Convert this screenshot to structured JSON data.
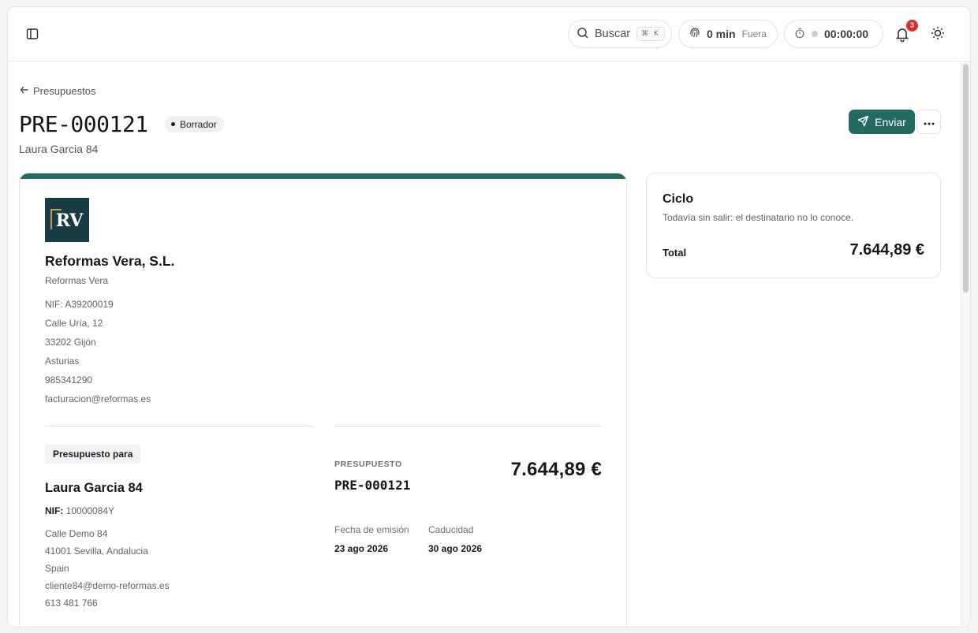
{
  "topbar": {
    "search": {
      "label": "Buscar",
      "shortcut": "⌘ K"
    },
    "presence": {
      "value": "0 min",
      "status": "Fuera"
    },
    "timer": {
      "value": "00:00:00"
    },
    "notifications": {
      "count": "3"
    },
    "icons": [
      "sidebar-toggle-icon",
      "search-icon",
      "fingerprint-icon",
      "stopwatch-icon",
      "bell-icon",
      "sun-icon"
    ]
  },
  "header": {
    "back_label": "Presupuestos",
    "title": "PRE-000121",
    "status": "Borrador",
    "subtitle": "Laura Garcia 84",
    "send_label": "Enviar",
    "more_label": "···"
  },
  "document": {
    "accent_color": "#236b62",
    "logo_text": "RV",
    "issuer": {
      "name": "Reformas Vera, S.L.",
      "trade_name": "Reformas Vera",
      "lines": [
        "NIF: A39200019",
        "Calle Uría, 12",
        "33202 Gijón",
        "Asturias",
        "985341290",
        "facturacion@reformas.es"
      ]
    },
    "client": {
      "tag": "Presupuesto para",
      "name": "Laura Garcia 84",
      "nif_label": "NIF:",
      "nif_value": "10000084Y",
      "lines": [
        "Calle Demo 84",
        "41001 Sevilla, Andalucia",
        "Spain",
        "cliente84@demo-reformas.es",
        "613 481 766"
      ]
    },
    "summary": {
      "label": "PRESUPUESTO",
      "number": "PRE-000121",
      "total": "7.644,89 €",
      "issue_date_label": "Fecha de emisión",
      "issue_date": "23 ago 2026",
      "expiry_label": "Caducidad",
      "expiry_date": "30 ago 2026"
    }
  },
  "cycle": {
    "title": "Ciclo",
    "description": "Todavía sin salir: el destinatario no lo conoce.",
    "total_label": "Total",
    "total_value": "7.644,89 €"
  }
}
